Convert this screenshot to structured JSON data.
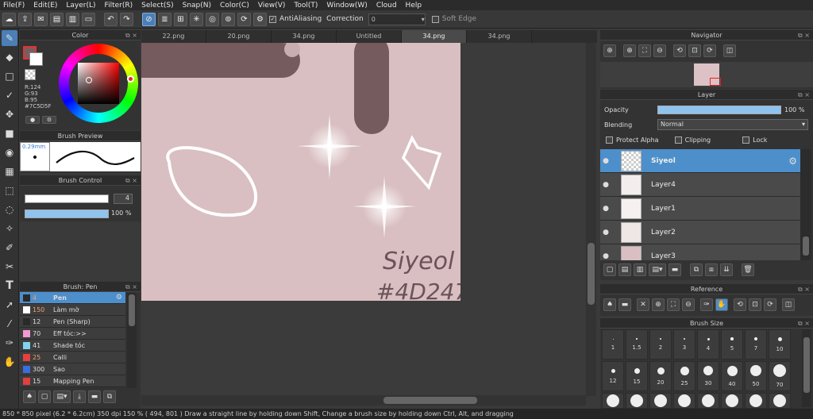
{
  "menu": [
    "File(F)",
    "Edit(E)",
    "Layer(L)",
    "Filter(R)",
    "Select(S)",
    "Snap(N)",
    "Color(C)",
    "View(V)",
    "Tool(T)",
    "Window(W)",
    "Cloud",
    "Help"
  ],
  "toolbar": {
    "antialiasing_label": "AntiAliasing",
    "correction_label": "Correction",
    "correction_value": "0",
    "soft_edge_label": "Soft Edge"
  },
  "color_panel": {
    "title": "Color",
    "r": "R:124",
    "g": "G:93",
    "b": "B:95",
    "hex": "#7C5D5F",
    "accent": "#7c5d5f"
  },
  "brush_preview": {
    "title": "Brush Preview",
    "size": "0.29mm"
  },
  "brush_control": {
    "title": "Brush Control",
    "size": "4",
    "opacity": "100 %"
  },
  "brushes": {
    "title": "Brush: Pen",
    "items": [
      {
        "size": "4",
        "name": "Pen",
        "color": "#2a2a2a"
      },
      {
        "size": "150",
        "name": "Làm mờ",
        "color": "#ffffff"
      },
      {
        "size": "12",
        "name": "Pen (Sharp)",
        "color": "#2a2a2a"
      },
      {
        "size": "70",
        "name": "Eff tóc:>>",
        "color": "#f29ad1"
      },
      {
        "size": "41",
        "name": "Shade tóc",
        "color": "#7fd3f0"
      },
      {
        "size": "25",
        "name": "Calli",
        "color": "#e64040"
      },
      {
        "size": "300",
        "name": "Sao",
        "color": "#3a6ee0"
      },
      {
        "size": "15",
        "name": "Mapping Pen",
        "color": "#e04040"
      }
    ]
  },
  "tabs": [
    "22.png",
    "20.png",
    "34.png",
    "Untitled",
    "34.png",
    "34.png"
  ],
  "navigator": {
    "title": "Navigator"
  },
  "layer_panel": {
    "title": "Layer",
    "opacity_label": "Opacity",
    "opacity_value": "100 %",
    "opacity_level": 1.0,
    "blending_label": "Blending",
    "blending_value": "Normal",
    "protect_alpha": "Protect Alpha",
    "clipping": "Clipping",
    "lock": "Lock",
    "layers": [
      "Siyeol",
      "Layer4",
      "Layer1",
      "Layer2",
      "Layer3"
    ]
  },
  "reference": {
    "title": "Reference"
  },
  "brush_size": {
    "title": "Brush Size",
    "row1": [
      "1",
      "1.5",
      "2",
      "3",
      "4",
      "5",
      "7",
      "10"
    ],
    "row2": [
      "12",
      "15",
      "20",
      "25",
      "30",
      "40",
      "50",
      "70"
    ]
  },
  "canvas": {
    "signature_line1": "Siyeol",
    "signature_line2": "#4D247"
  },
  "status": "850 * 850 pixel   (6.2 * 6.2cm)   350 dpi   150 %   ( 494, 801 )   Draw a straight line by holding down Shift, Change a brush size by holding down Ctrl, Alt, and dragging"
}
